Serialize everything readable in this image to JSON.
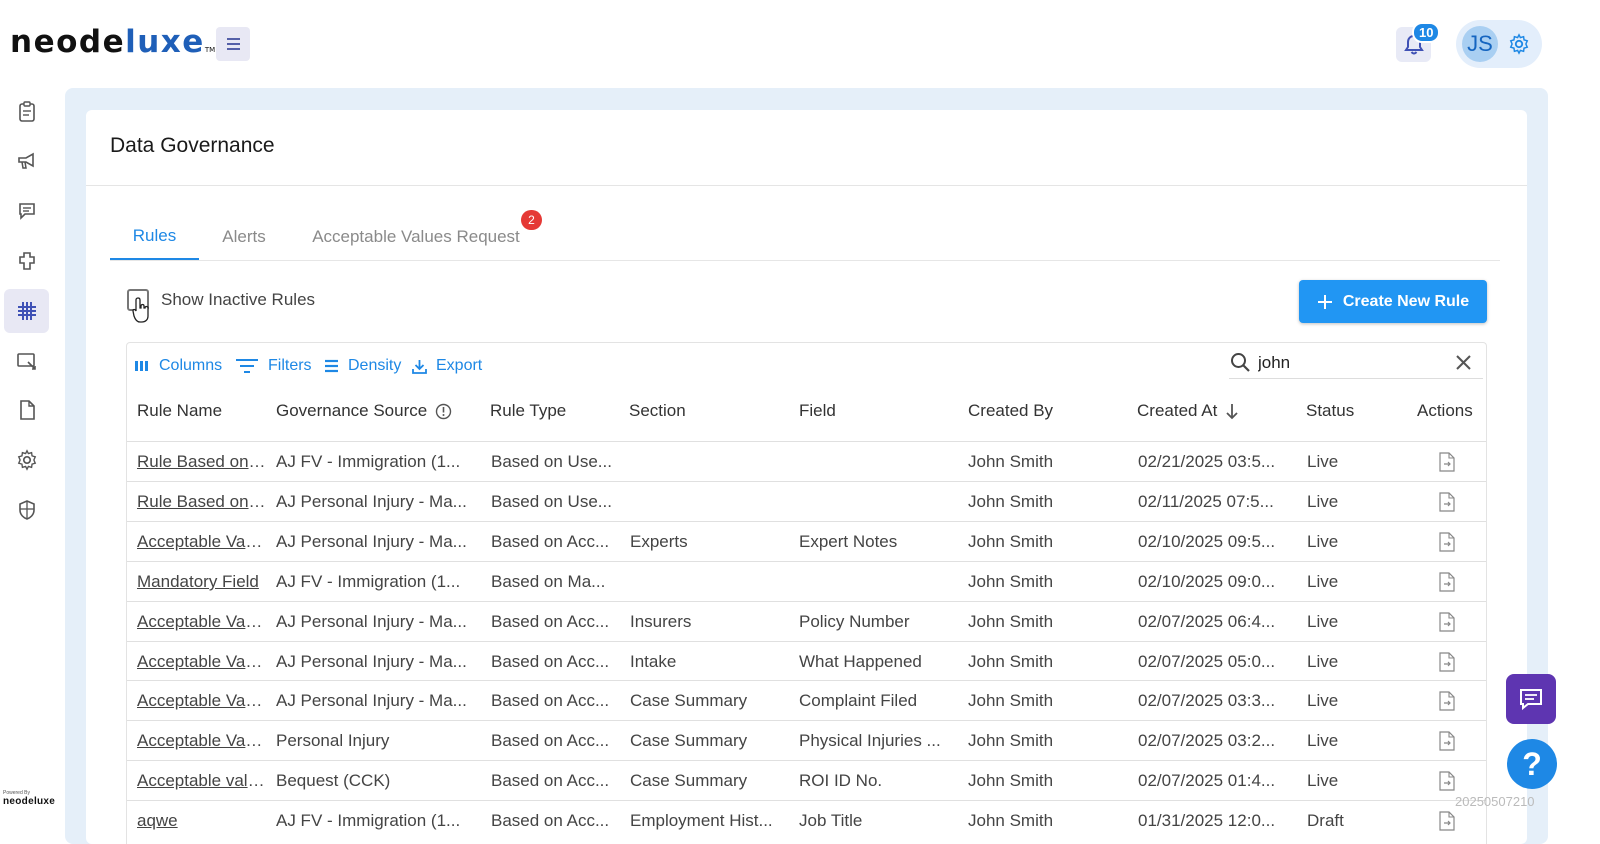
{
  "brand": {
    "name_part1": "neode",
    "name_part2": "luxe",
    "tm": "TM",
    "powered_by": "Powered By",
    "powered_name": "neodeluxe"
  },
  "header": {
    "notification_count": "10",
    "avatar_initials": "JS"
  },
  "sidebar": {
    "items": [
      {
        "icon": "clipboard-icon"
      },
      {
        "icon": "megaphone-icon"
      },
      {
        "icon": "chat-icon"
      },
      {
        "icon": "plugin-icon"
      },
      {
        "icon": "grid-hash-icon",
        "active": true
      },
      {
        "icon": "screen-share-icon"
      },
      {
        "icon": "document-icon"
      },
      {
        "icon": "settings-icon"
      },
      {
        "icon": "shield-icon"
      }
    ]
  },
  "page": {
    "title": "Data Governance"
  },
  "tabs": [
    {
      "label": "Rules",
      "active": true
    },
    {
      "label": "Alerts"
    },
    {
      "label": "Acceptable Values Request",
      "badge": "2"
    }
  ],
  "controls": {
    "show_inactive_label": "Show Inactive Rules",
    "create_button": "Create New Rule"
  },
  "toolbar": {
    "columns": "Columns",
    "filters": "Filters",
    "density": "Density",
    "export": "Export"
  },
  "search": {
    "value": "john"
  },
  "table": {
    "columns": [
      "Rule Name",
      "Governance Source",
      "Rule Type",
      "Section",
      "Field",
      "Created By",
      "Created At",
      "Status",
      "Actions"
    ],
    "rows": [
      {
        "name": "Rule Based on User",
        "source": "AJ FV - Immigration (1...",
        "type": "Based on Use...",
        "section": "",
        "field": "",
        "created_by": "John Smith",
        "created_at": "02/21/2025 03:5...",
        "status": "Live"
      },
      {
        "name": "Rule Based on User",
        "source": "AJ Personal Injury - Ma...",
        "type": "Based on Use...",
        "section": "",
        "field": "",
        "created_by": "John Smith",
        "created_at": "02/11/2025 07:5...",
        "status": "Live"
      },
      {
        "name": "Acceptable Values",
        "source": "AJ Personal Injury - Ma...",
        "type": "Based on Acc...",
        "section": "Experts",
        "field": "Expert Notes",
        "created_by": "John Smith",
        "created_at": "02/10/2025 09:5...",
        "status": "Live"
      },
      {
        "name": "Mandatory Field",
        "source": "AJ FV - Immigration (1...",
        "type": "Based on Ma...",
        "section": "",
        "field": "",
        "created_by": "John Smith",
        "created_at": "02/10/2025 09:0...",
        "status": "Live"
      },
      {
        "name": "Acceptable Values",
        "source": "AJ Personal Injury - Ma...",
        "type": "Based on Acc...",
        "section": "Insurers",
        "field": "Policy Number",
        "created_by": "John Smith",
        "created_at": "02/07/2025 06:4...",
        "status": "Live"
      },
      {
        "name": "Acceptable Values",
        "source": "AJ Personal Injury - Ma...",
        "type": "Based on Acc...",
        "section": "Intake",
        "field": "What Happened",
        "created_by": "John Smith",
        "created_at": "02/07/2025 05:0...",
        "status": "Live"
      },
      {
        "name": "Acceptable Values",
        "source": "AJ Personal Injury - Ma...",
        "type": "Based on Acc...",
        "section": "Case Summary",
        "field": "Complaint Filed",
        "created_by": "John Smith",
        "created_at": "02/07/2025 03:3...",
        "status": "Live"
      },
      {
        "name": "Acceptable Values",
        "source": "Personal Injury",
        "type": "Based on Acc...",
        "section": "Case Summary",
        "field": "Physical Injuries ...",
        "created_by": "John Smith",
        "created_at": "02/07/2025 03:2...",
        "status": "Live"
      },
      {
        "name": "Acceptable values",
        "source": "Bequest (CCK)",
        "type": "Based on Acc...",
        "section": "Case Summary",
        "field": "ROI ID No.",
        "created_by": "John Smith",
        "created_at": "02/07/2025 01:4...",
        "status": "Live"
      },
      {
        "name": "aqwe",
        "source": "AJ FV - Immigration (1...",
        "type": "Based on Acc...",
        "section": "Employment Hist...",
        "field": "Job Title",
        "created_by": "John Smith",
        "created_at": "01/31/2025 12:0...",
        "status": "Draft"
      }
    ]
  },
  "watermark": "20250507210",
  "colors": {
    "accent": "#1e88e5",
    "chat": "#5e35b1",
    "badge": "#e53935"
  }
}
